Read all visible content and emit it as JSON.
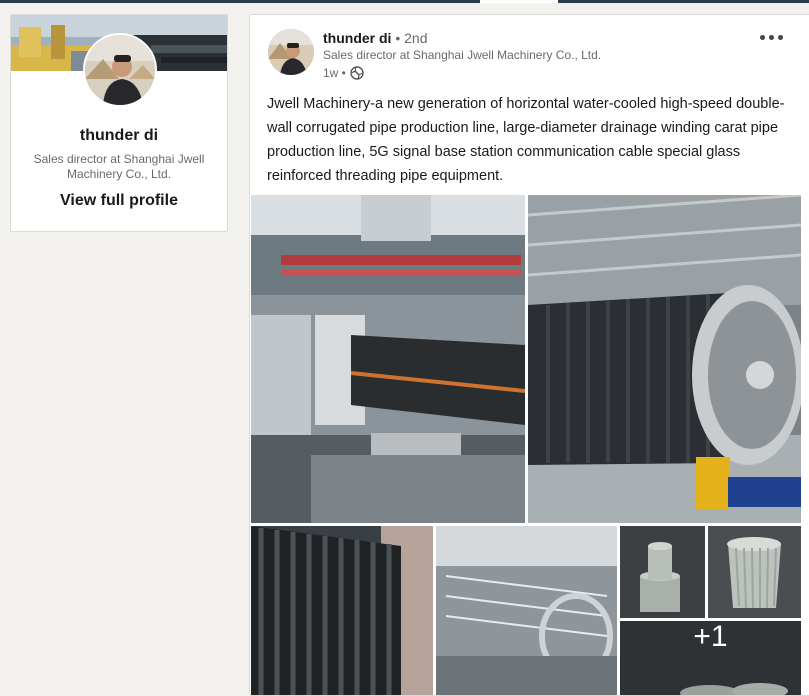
{
  "profile": {
    "name": "thunder di",
    "headline": "Sales director at Shanghai Jwell Machinery Co., Ltd.",
    "view_profile_label": "View full profile"
  },
  "post": {
    "author": "thunder di",
    "degree": "• 2nd",
    "headline": "Sales director at Shanghai Jwell Machinery Co., Ltd.",
    "time": "1w •",
    "visibility_icon": "globe-icon",
    "menu_icon": "more-options-icon",
    "text": "Jwell Machinery-a new generation of horizontal water-cooled high-speed double-wall corrugated pipe production line, large-diameter drainage winding carat pipe production line, 5G signal base station communication cable special glass reinforced threading pipe equipment.",
    "more_images_count": "+1"
  },
  "colors": {
    "page_bg": "#f3f2ef",
    "card_bg": "#ffffff",
    "secondary_text": "#666666",
    "topbar": "#2b3b4a"
  }
}
